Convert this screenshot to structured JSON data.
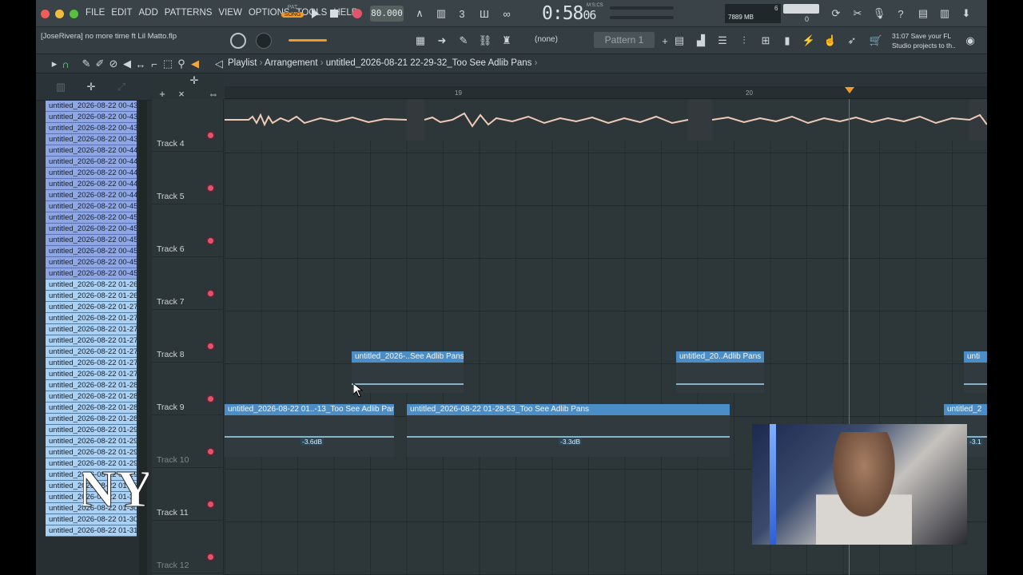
{
  "menu": [
    "FILE",
    "EDIT",
    "ADD",
    "PATTERNS",
    "VIEW",
    "OPTIONS",
    "TOOLS",
    "HELP"
  ],
  "transport": {
    "mode_pat": "PAT",
    "mode_song": "SONG",
    "tempo": "80.000",
    "time": "0:58",
    "time_frac": "06",
    "time_unit": "M:S:CS",
    "memory": "7889 MB",
    "cpu_value": "6",
    "cpu_zero": "0"
  },
  "hint": {
    "file": "[JoseRivera] no more time ft Lil Matto.flp",
    "line1": "31:07  Save your FL",
    "line2": "Studio projects to th.."
  },
  "pattern": {
    "none_label": "(none)",
    "pattern_label": "Pattern 1"
  },
  "breadcrumb": {
    "playlist": "Playlist",
    "arrangement": "Arrangement",
    "project": "untitled_2026-08-21 22-29-32_Too See Adlib Pans"
  },
  "ruler": {
    "mark1": "19",
    "mark2": "20"
  },
  "files": [
    "untitled_2026-08-22 00-43...",
    "untitled_2026-08-22 00-43...",
    "untitled_2026-08-22 00-43...",
    "untitled_2026-08-22 00-43...",
    "untitled_2026-08-22 00-44...",
    "untitled_2026-08-22 00-44...",
    "untitled_2026-08-22 00-44...",
    "untitled_2026-08-22 00-44...",
    "untitled_2026-08-22 00-44...",
    "untitled_2026-08-22 00-45...",
    "untitled_2026-08-22 00-45...",
    "untitled_2026-08-22 00-45...",
    "untitled_2026-08-22 00-45...",
    "untitled_2026-08-22 00-45...",
    "untitled_2026-08-22 00-45...",
    "untitled_2026-08-22 00-45...",
    "untitled_2026-08-22 01-26...",
    "untitled_2026-08-22 01-26...",
    "untitled_2026-08-22 01-27...",
    "untitled_2026-08-22 01-27...",
    "untitled_2026-08-22 01-27...",
    "untitled_2026-08-22 01-27...",
    "untitled_2026-08-22 01-27...",
    "untitled_2026-08-22 01-27...",
    "untitled_2026-08-22 01-27...",
    "untitled_2026-08-22 01-28...",
    "untitled_2026-08-22 01-28...",
    "untitled_2026-08-22 01-28...",
    "untitled_2026-08-22 01-28...",
    "untitled_2026-08-22 01-29...",
    "untitled_2026-08-22 01-29...",
    "untitled_2026-08-22 01-29...",
    "untitled_2026-08-22 01-29...",
    "untitled_2026-08-22 01-29...",
    "untitled_2026-08-22 01-29...",
    "untitled_2026-08-22 01-30...",
    "untitled_2026-08-22 01-30...",
    "untitled_2026-08-22 01-30...",
    "untitled_2026-08-22 01-31..."
  ],
  "tracks": [
    "Track 4",
    "Track 5",
    "Track 6",
    "Track 7",
    "Track 8",
    "Track 9",
    "Track 10",
    "Track 11",
    "Track 12"
  ],
  "clips": {
    "t8a": {
      "label": "untitled_2026-..See Adlib Pans"
    },
    "t8b": {
      "label": "untitled_20..Adlib Pans"
    },
    "t8c": {
      "label": "unti"
    },
    "t9a": {
      "label": "untitled_2026-08-22 01..-13_Too See Adlib Pans",
      "gain": "-3.6dB"
    },
    "t9b": {
      "label": "untitled_2026-08-22 01-28-53_Too See Adlib Pans",
      "gain": "-3.3dB"
    },
    "t9c": {
      "label": "untitled_2",
      "gain": "-3.1"
    }
  },
  "colors": {
    "clip_header": "#4b8ec7",
    "waveform": "#9fd2ea",
    "audio_waveform": "#f0cbb8",
    "record": "#e0556a",
    "song_mode": "#f29a28"
  }
}
